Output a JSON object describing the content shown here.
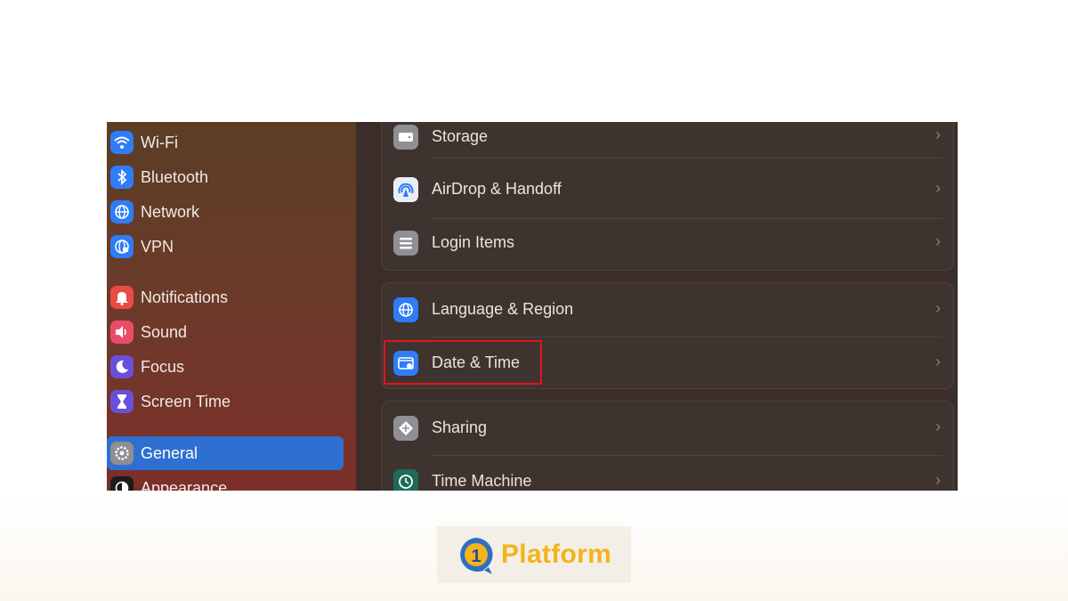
{
  "sidebar": {
    "items": [
      {
        "label": "Wi-Fi",
        "icon": "wifi-icon",
        "color": "#2f7cf6"
      },
      {
        "label": "Bluetooth",
        "icon": "bluetooth-icon",
        "color": "#2f7cf6"
      },
      {
        "label": "Network",
        "icon": "globe-icon",
        "color": "#2f7cf6"
      },
      {
        "label": "VPN",
        "icon": "vpn-globe-icon",
        "color": "#2f7cf6"
      },
      {
        "label": "Notifications",
        "icon": "bell-icon",
        "color": "#ea4b44"
      },
      {
        "label": "Sound",
        "icon": "speaker-icon",
        "color": "#ea4b6a"
      },
      {
        "label": "Focus",
        "icon": "moon-icon",
        "color": "#6a4fd9"
      },
      {
        "label": "Screen Time",
        "icon": "hourglass-icon",
        "color": "#6a4fd9"
      },
      {
        "label": "General",
        "icon": "gear-icon",
        "color": "#8e8e93",
        "selected": true
      },
      {
        "label": "Appearance",
        "icon": "appearance-icon",
        "color": "#1c1c1e"
      }
    ],
    "selected_color": "#2f6fd1"
  },
  "groups": [
    {
      "rows": [
        {
          "label": "Storage",
          "icon": "storage-drive-icon"
        },
        {
          "label": "AirDrop & Handoff",
          "icon": "airdrop-icon"
        },
        {
          "label": "Login Items",
          "icon": "list-icon"
        }
      ]
    },
    {
      "rows": [
        {
          "label": "Language & Region",
          "icon": "globe-icon"
        },
        {
          "label": "Date & Time",
          "icon": "calendar-clock-icon",
          "highlighted": true
        }
      ]
    },
    {
      "rows": [
        {
          "label": "Sharing",
          "icon": "sharing-icon"
        },
        {
          "label": "Time Machine",
          "icon": "time-machine-icon"
        }
      ]
    }
  ],
  "chevron": "›",
  "highlight_color": "#e3141b",
  "logo": {
    "number": "1",
    "text": "Platform",
    "color": "#f4b21c"
  }
}
